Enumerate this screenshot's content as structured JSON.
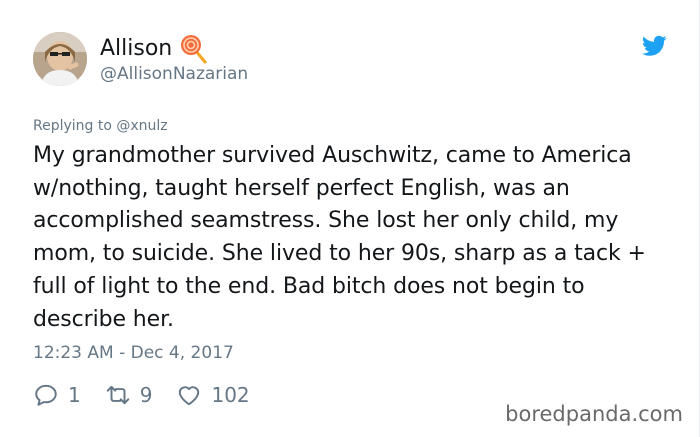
{
  "user": {
    "display_name": "Allison",
    "handle": "@AllisonNazarian"
  },
  "tweet": {
    "replying_to": "Replying to @xnulz",
    "text": "My grandmother survived Auschwitz, came to America w/nothing, taught herself perfect English, was an accomplished seamstress. She lost her only child, my mom, to suicide. She lived to her 90s, sharp as a tack + full of light to the end. Bad bitch does not begin to describe her.",
    "timestamp": "12:23 AM - Dec 4, 2017"
  },
  "actions": {
    "replies": "1",
    "retweets": "9",
    "likes": "102"
  },
  "watermark": "boredpanda.com",
  "colors": {
    "text": "#14171a",
    "muted": "#657786",
    "twitter_blue": "#1da1f2"
  }
}
